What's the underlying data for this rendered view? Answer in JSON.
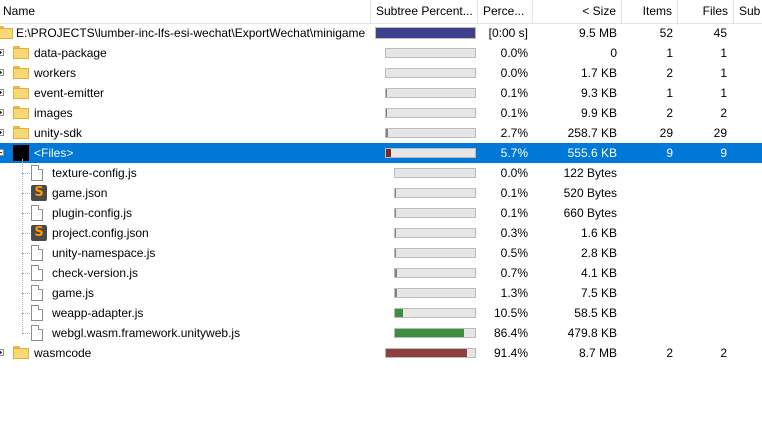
{
  "columns": {
    "name": "Name",
    "subtree_percent": "Subtree Percent...",
    "percent": "Perce...",
    "size": "< Size",
    "items": "Items",
    "files": "Files",
    "sub": "Sub"
  },
  "colors": {
    "selection": "#0078d7",
    "bar_root": "#3f3f8f",
    "bar_small": "#808080",
    "bar_green": "#3c8f3c",
    "bar_red": "#8f3f3f",
    "bar_selected": "#7a2a2a"
  },
  "rows": [
    {
      "name": "E:\\PROJECTS\\lumber-inc-lfs-esi-wechat\\ExportWechat\\minigame",
      "icon": "folder-icon",
      "level": 0,
      "expander": "none",
      "subtree": 1.0,
      "percent": "[0:00 s]",
      "size": "9.5 MB",
      "items": "52",
      "files": "45",
      "bar": "root"
    },
    {
      "name": "data-package",
      "icon": "folder-icon",
      "level": 1,
      "expander": "plus",
      "subtree": 0.0,
      "percent": "0.0%",
      "size": "0",
      "items": "1",
      "files": "1",
      "bar": "small"
    },
    {
      "name": "workers",
      "icon": "folder-icon",
      "level": 1,
      "expander": "plus",
      "subtree": 0.0,
      "percent": "0.0%",
      "size": "1.7 KB",
      "items": "2",
      "files": "1",
      "bar": "small"
    },
    {
      "name": "event-emitter",
      "icon": "folder-icon",
      "level": 1,
      "expander": "plus",
      "subtree": 0.001,
      "percent": "0.1%",
      "size": "9.3 KB",
      "items": "1",
      "files": "1",
      "bar": "small"
    },
    {
      "name": "images",
      "icon": "folder-icon",
      "level": 1,
      "expander": "plus",
      "subtree": 0.001,
      "percent": "0.1%",
      "size": "9.9 KB",
      "items": "2",
      "files": "2",
      "bar": "small"
    },
    {
      "name": "unity-sdk",
      "icon": "folder-icon",
      "level": 1,
      "expander": "plus",
      "subtree": 0.027,
      "percent": "2.7%",
      "size": "258.7 KB",
      "items": "29",
      "files": "29",
      "bar": "small"
    },
    {
      "name": "<Files>",
      "icon": "black-icon",
      "level": 1,
      "expander": "minus",
      "subtree": 0.057,
      "percent": "5.7%",
      "size": "555.6 KB",
      "items": "9",
      "files": "9",
      "bar": "selected",
      "selected": true
    },
    {
      "name": "texture-config.js",
      "icon": "file-icon",
      "level": 2,
      "expander": "none",
      "subtree": 0.0,
      "percent": "0.0%",
      "size": "122 Bytes",
      "items": "",
      "files": "",
      "bar": "small"
    },
    {
      "name": "game.json",
      "icon": "sublime-icon",
      "level": 2,
      "expander": "none",
      "subtree": 0.001,
      "percent": "0.1%",
      "size": "520 Bytes",
      "items": "",
      "files": "",
      "bar": "small"
    },
    {
      "name": "plugin-config.js",
      "icon": "file-icon",
      "level": 2,
      "expander": "none",
      "subtree": 0.001,
      "percent": "0.1%",
      "size": "660 Bytes",
      "items": "",
      "files": "",
      "bar": "small"
    },
    {
      "name": "project.config.json",
      "icon": "sublime-icon",
      "level": 2,
      "expander": "none",
      "subtree": 0.003,
      "percent": "0.3%",
      "size": "1.6 KB",
      "items": "",
      "files": "",
      "bar": "small"
    },
    {
      "name": "unity-namespace.js",
      "icon": "file-icon",
      "level": 2,
      "expander": "none",
      "subtree": 0.005,
      "percent": "0.5%",
      "size": "2.8 KB",
      "items": "",
      "files": "",
      "bar": "small"
    },
    {
      "name": "check-version.js",
      "icon": "file-icon",
      "level": 2,
      "expander": "none",
      "subtree": 0.007,
      "percent": "0.7%",
      "size": "4.1 KB",
      "items": "",
      "files": "",
      "bar": "small"
    },
    {
      "name": "game.js",
      "icon": "file-icon",
      "level": 2,
      "expander": "none",
      "subtree": 0.013,
      "percent": "1.3%",
      "size": "7.5 KB",
      "items": "",
      "files": "",
      "bar": "small"
    },
    {
      "name": "weapp-adapter.js",
      "icon": "file-icon",
      "level": 2,
      "expander": "none",
      "subtree": 0.105,
      "percent": "10.5%",
      "size": "58.5 KB",
      "items": "",
      "files": "",
      "bar": "green"
    },
    {
      "name": "webgl.wasm.framework.unityweb.js",
      "icon": "file-icon",
      "level": 2,
      "expander": "none",
      "subtree": 0.864,
      "percent": "86.4%",
      "size": "479.8 KB",
      "items": "",
      "files": "",
      "bar": "green"
    },
    {
      "name": "wasmcode",
      "icon": "folder-icon",
      "level": 1,
      "expander": "plus",
      "subtree": 0.914,
      "percent": "91.4%",
      "size": "8.7 MB",
      "items": "2",
      "files": "2",
      "bar": "red"
    }
  ]
}
